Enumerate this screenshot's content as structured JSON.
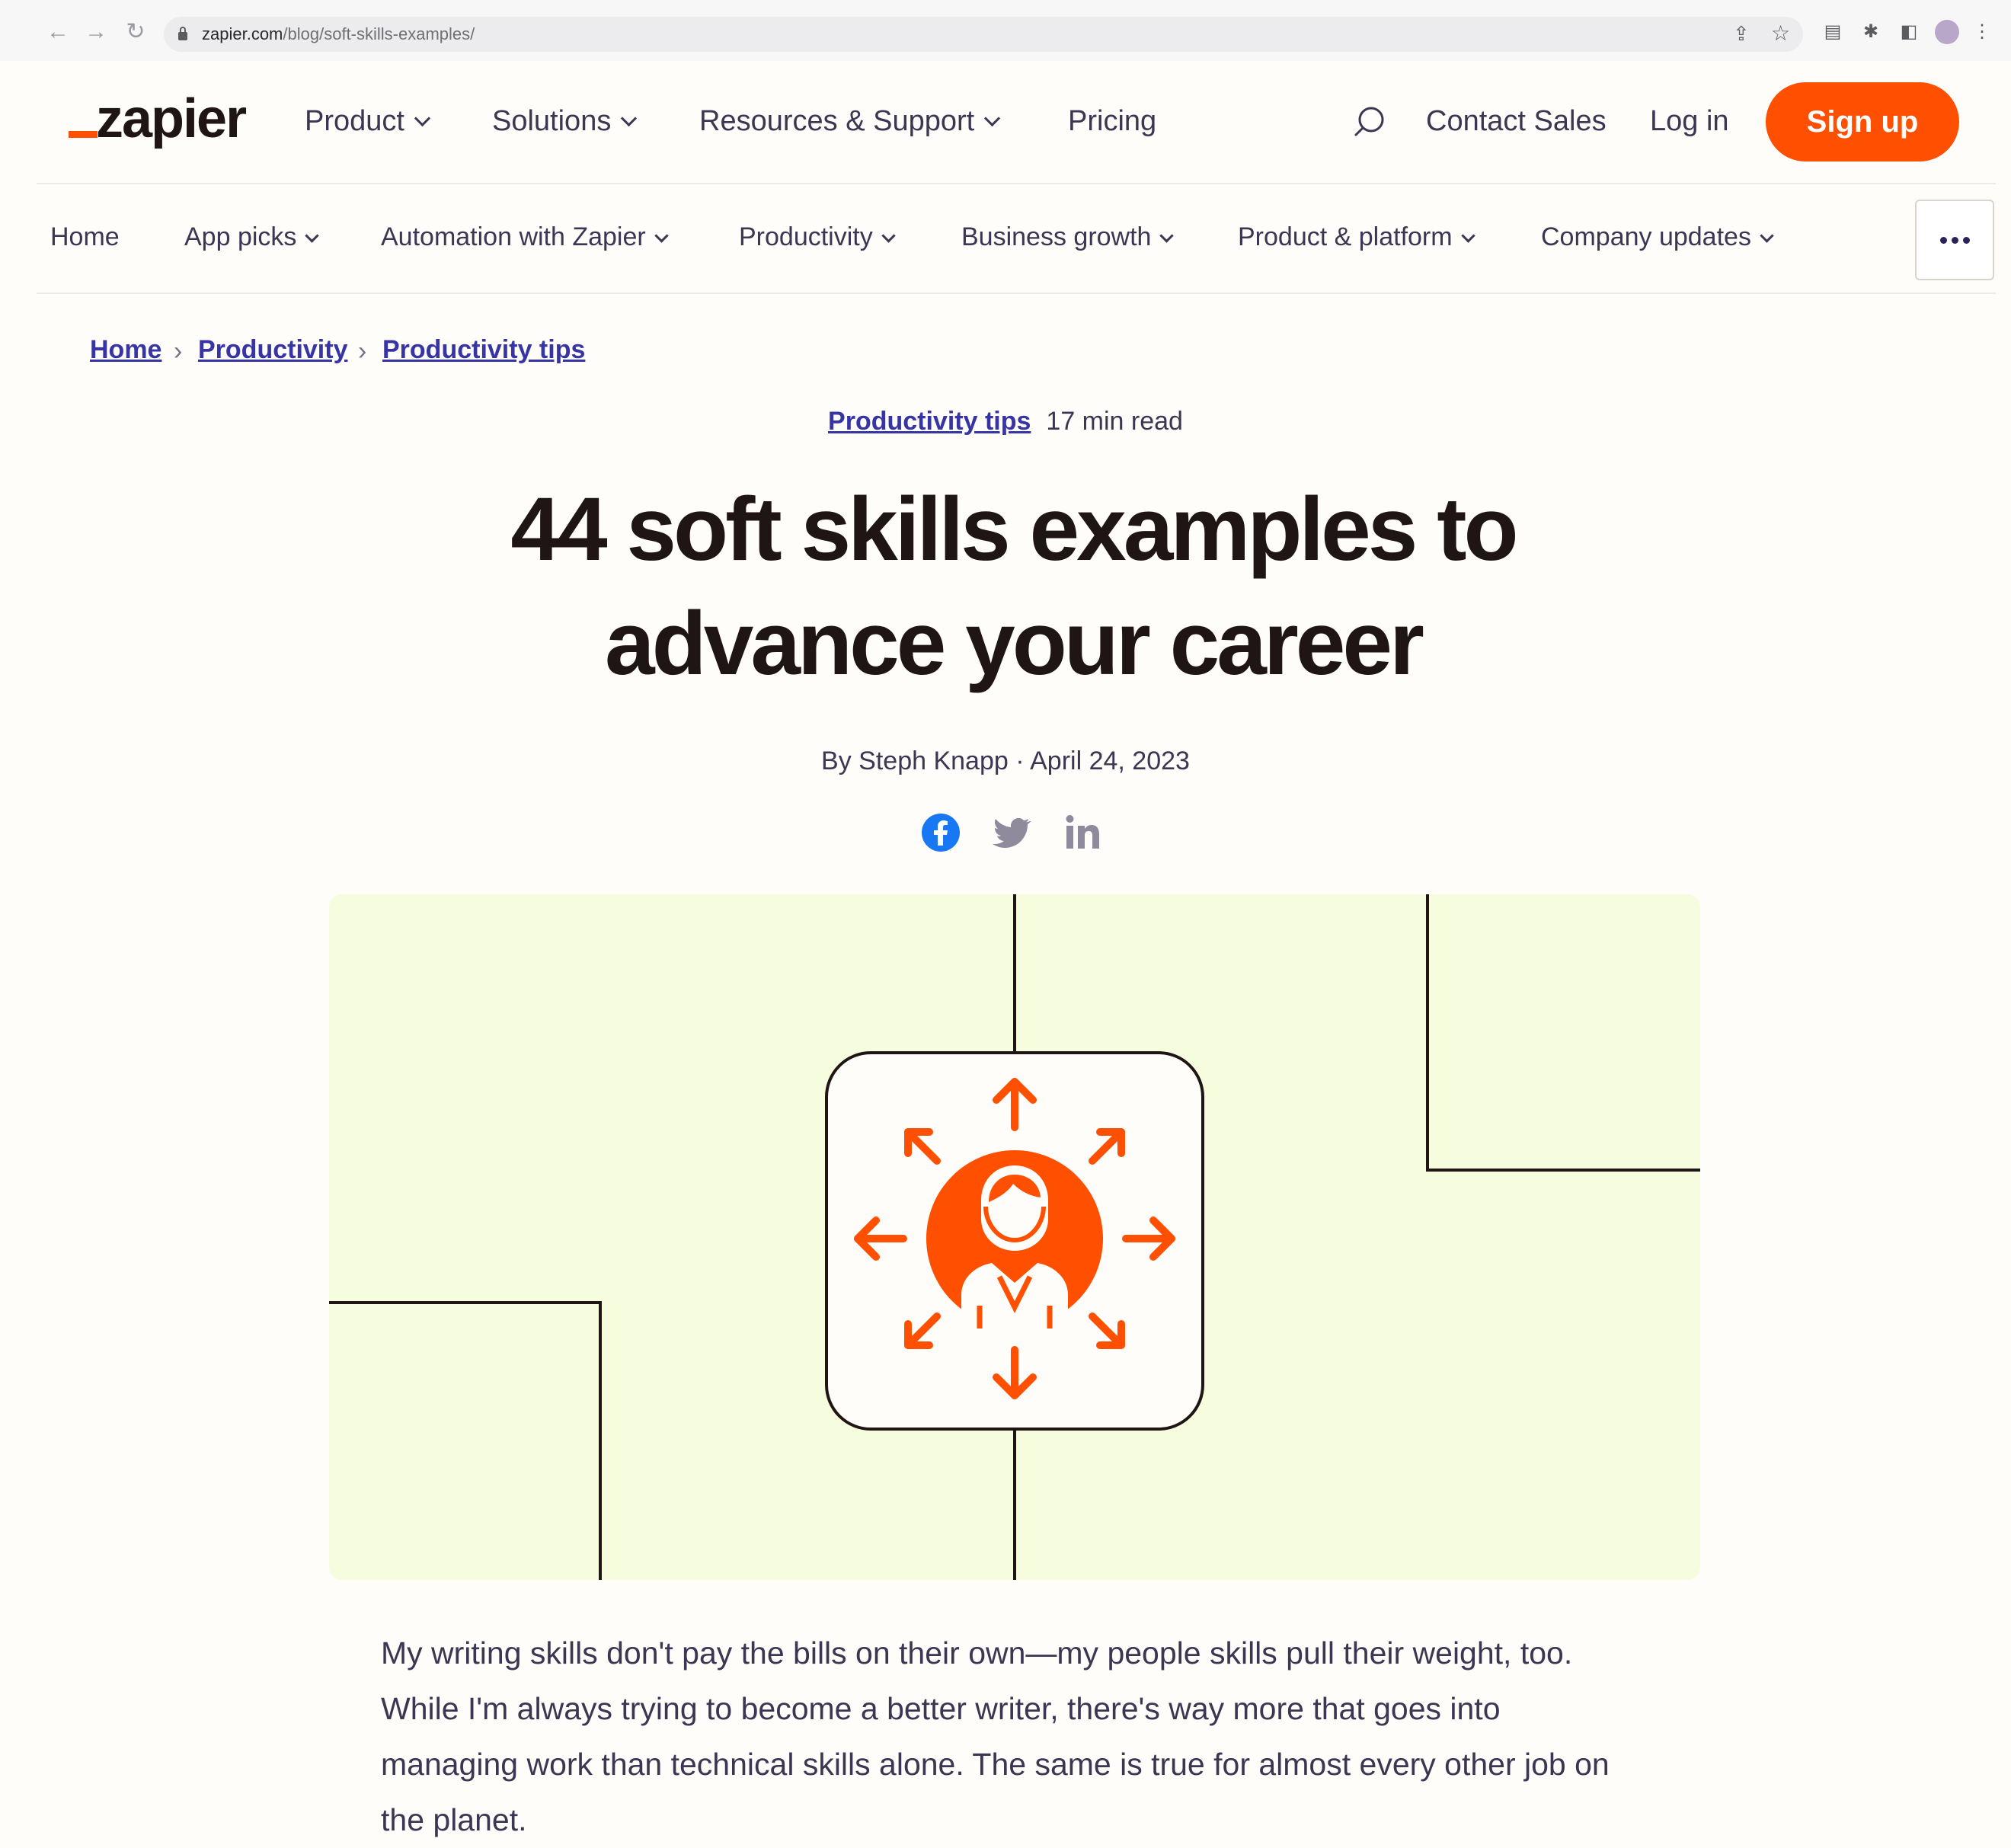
{
  "browser": {
    "url_domain": "zapier.com",
    "url_path": "/blog/soft-skills-examples/"
  },
  "header": {
    "logo_text": "zapier",
    "nav": [
      {
        "label": "Product",
        "has_dropdown": true
      },
      {
        "label": "Solutions",
        "has_dropdown": true
      },
      {
        "label": "Resources & Support",
        "has_dropdown": true
      },
      {
        "label": "Pricing",
        "has_dropdown": false
      }
    ],
    "contact_sales": "Contact Sales",
    "log_in": "Log in",
    "sign_up": "Sign up"
  },
  "subnav": {
    "items": [
      {
        "label": "Home"
      },
      {
        "label": "App picks"
      },
      {
        "label": "Automation with Zapier"
      },
      {
        "label": "Productivity"
      },
      {
        "label": "Business growth"
      },
      {
        "label": "Product & platform"
      },
      {
        "label": "Company updates"
      }
    ]
  },
  "breadcrumb": [
    {
      "label": "Home"
    },
    {
      "label": "Productivity"
    },
    {
      "label": "Productivity tips"
    }
  ],
  "article": {
    "category": "Productivity tips",
    "read_time": "17 min read",
    "title_line1": "44 soft skills examples to",
    "title_line2": "advance your career",
    "byline": "By Steph Knapp · April 24, 2023",
    "intro": "My writing skills don't pay the bills on their own—my people skills pull their weight, too. While I'm always trying to become a better writer, there's way more that goes into managing work than technical skills alone. The same is true for almost every other job on the planet."
  },
  "share": [
    "facebook-icon",
    "twitter-icon",
    "linkedin-icon"
  ],
  "colors": {
    "brand_orange": "#ff4f00",
    "link_blue": "#3734a4",
    "hero_background": "#f6fdde",
    "page_background": "#fffdf9"
  }
}
